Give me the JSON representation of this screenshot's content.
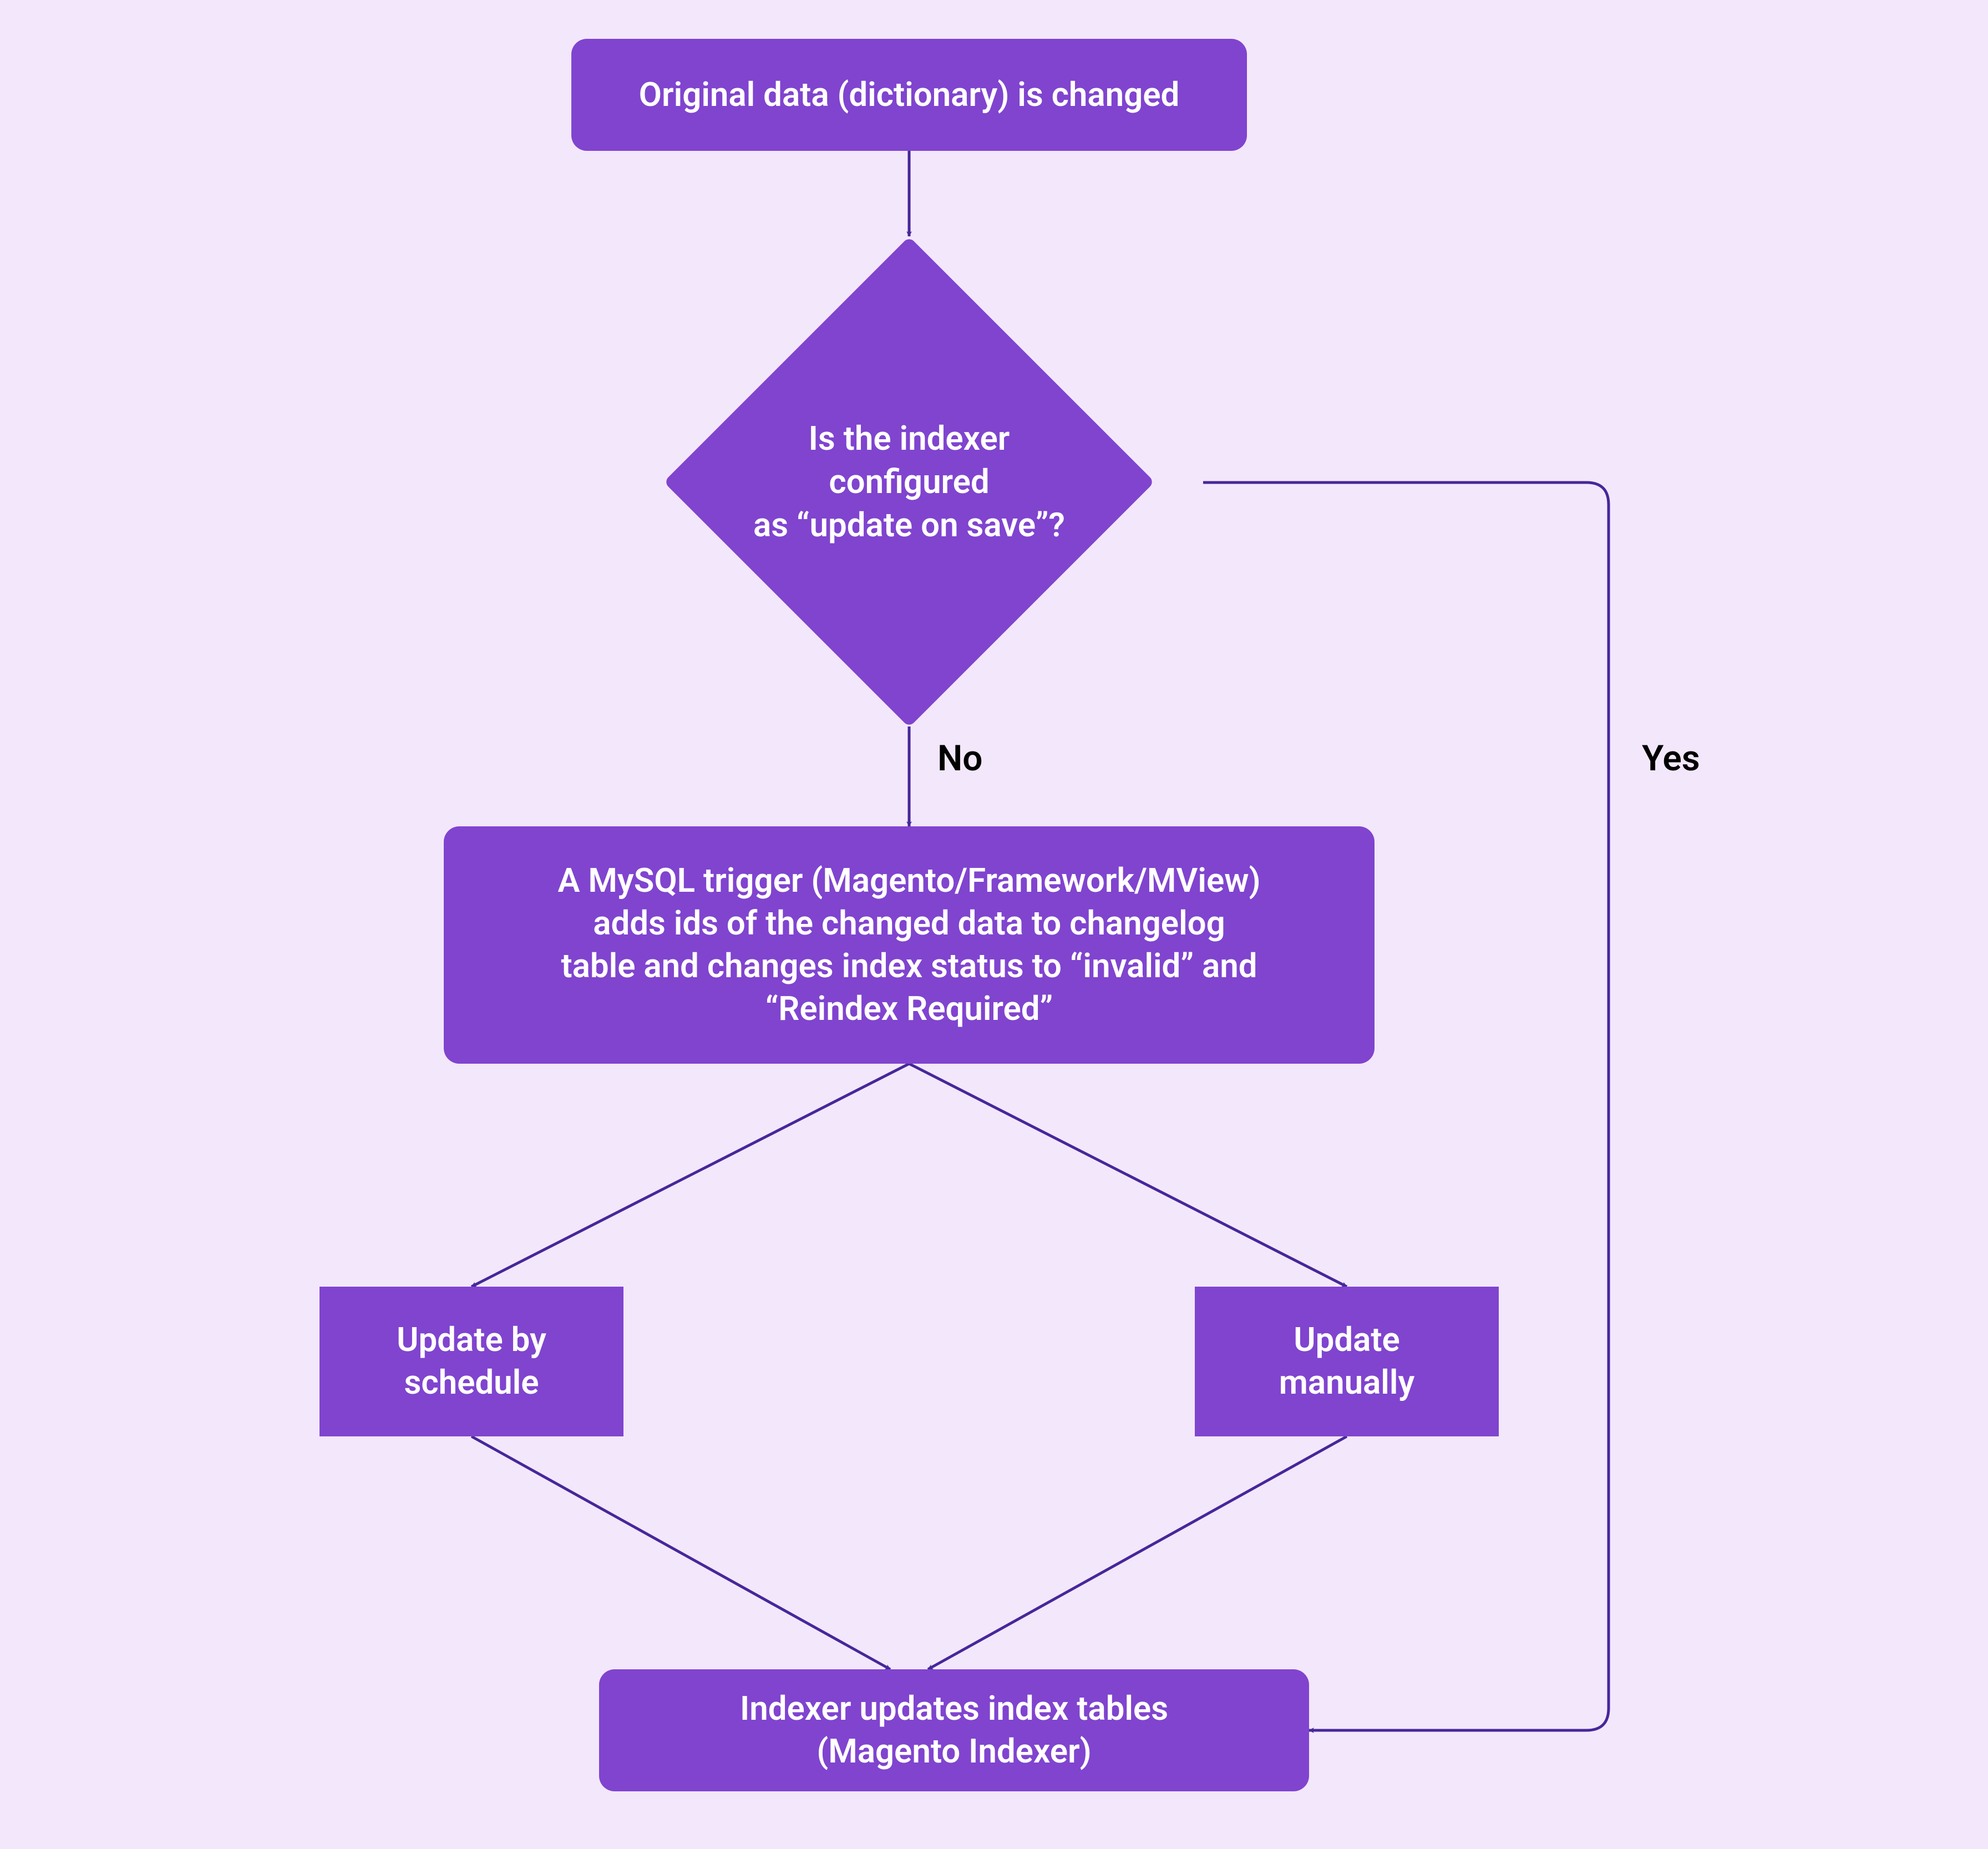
{
  "colors": {
    "background": "#f3e7fb",
    "node_fill": "#8044cf",
    "node_text": "#ffffff",
    "edge_stroke": "#46279a",
    "label_text": "#000000"
  },
  "nodes": {
    "start": {
      "text": "Original data (dictionary) is changed"
    },
    "decision": {
      "line1": "Is the indexer configured",
      "line2": "as “update on save”?"
    },
    "trigger": {
      "line1": "A MySQL trigger (Magento/Framework/MView)",
      "line2": "adds ids of the changed data to changelog",
      "line3": "table and changes index status to “invalid” and",
      "line4": "“Reindex Required”"
    },
    "update_schedule": {
      "line1": "Update by",
      "line2": "schedule"
    },
    "update_manual": {
      "line1": "Update",
      "line2": "manually"
    },
    "end": {
      "line1": "Indexer updates index tables",
      "line2": "(Magento Indexer)"
    }
  },
  "edges": {
    "no_label": "No",
    "yes_label": "Yes"
  },
  "chart_data": {
    "type": "flowchart",
    "nodes": [
      {
        "id": "start",
        "shape": "rounded-rect",
        "text": "Original data (dictionary) is changed"
      },
      {
        "id": "decision",
        "shape": "diamond",
        "text": "Is the indexer configured as “update on save”?"
      },
      {
        "id": "trigger",
        "shape": "rounded-rect",
        "text": "A MySQL trigger (Magento/Framework/MView) adds ids of the changed data to changelog table and changes index status to “invalid” and “Reindex Required”"
      },
      {
        "id": "update_schedule",
        "shape": "rect",
        "text": "Update by schedule"
      },
      {
        "id": "update_manual",
        "shape": "rect",
        "text": "Update manually"
      },
      {
        "id": "end",
        "shape": "rounded-rect",
        "text": "Indexer updates index tables (Magento Indexer)"
      }
    ],
    "edges": [
      {
        "from": "start",
        "to": "decision",
        "label": ""
      },
      {
        "from": "decision",
        "to": "trigger",
        "label": "No"
      },
      {
        "from": "decision",
        "to": "end",
        "label": "Yes"
      },
      {
        "from": "trigger",
        "to": "update_schedule",
        "label": ""
      },
      {
        "from": "trigger",
        "to": "update_manual",
        "label": ""
      },
      {
        "from": "update_schedule",
        "to": "end",
        "label": ""
      },
      {
        "from": "update_manual",
        "to": "end",
        "label": ""
      }
    ]
  }
}
